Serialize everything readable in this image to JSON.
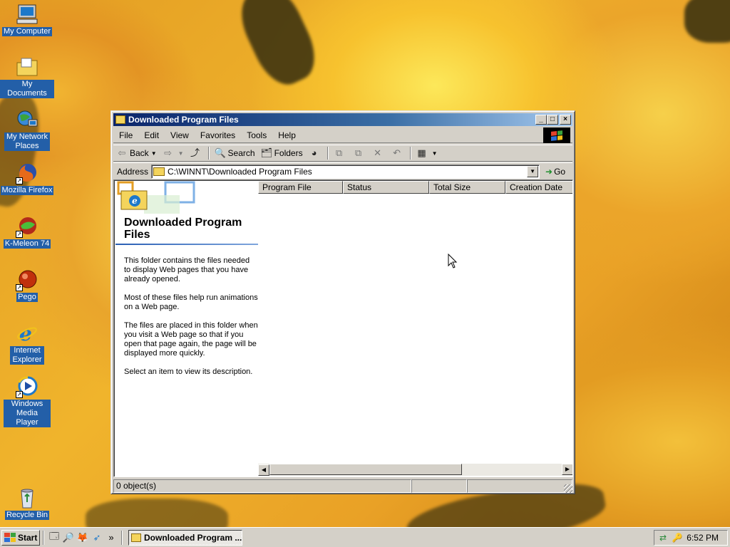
{
  "desktop": {
    "icons": [
      {
        "label": "My Computer",
        "icon": "my-computer-icon"
      },
      {
        "label": "My Documents",
        "icon": "my-documents-icon"
      },
      {
        "label": "My Network Places",
        "icon": "network-places-icon"
      },
      {
        "label": "Mozilla Firefox",
        "icon": "firefox-icon"
      },
      {
        "label": "K-Meleon 74",
        "icon": "kmeleon-icon"
      },
      {
        "label": "Pego",
        "icon": "pego-icon"
      },
      {
        "label": "Internet Explorer",
        "icon": "internet-explorer-icon"
      },
      {
        "label": "Windows Media Player",
        "icon": "media-player-icon"
      },
      {
        "label": "Recycle Bin",
        "icon": "recycle-bin-icon"
      }
    ]
  },
  "window": {
    "title": "Downloaded Program Files",
    "menu": [
      "File",
      "Edit",
      "View",
      "Favorites",
      "Tools",
      "Help"
    ],
    "toolbar": {
      "back_label": "Back",
      "search_label": "Search",
      "folders_label": "Folders"
    },
    "address": {
      "label": "Address",
      "value": "C:\\WINNT\\Downloaded Program Files",
      "go_label": "Go"
    },
    "webview": {
      "title": "Downloaded Program Files",
      "paragraphs": [
        "This folder contains the files needed to display Web pages that you have already opened.",
        "Most of these files help run animations on a Web page.",
        "The files are placed in this folder when you visit a Web page so that if you open that page again, the page will be displayed more quickly.",
        "Select an item to view its description."
      ]
    },
    "columns": [
      "Program File",
      "Status",
      "Total Size",
      "Creation Date"
    ],
    "status": {
      "objects": "0 object(s)"
    }
  },
  "taskbar": {
    "start_label": "Start",
    "task_label": "Downloaded Program ...",
    "clock": "6:52 PM",
    "chevron": "»"
  },
  "colors": {
    "title_active_start": "#0a246a",
    "title_active_end": "#a6caf0",
    "desktop_label_bg": "#235fa8",
    "chrome": "#d4d0c8"
  }
}
